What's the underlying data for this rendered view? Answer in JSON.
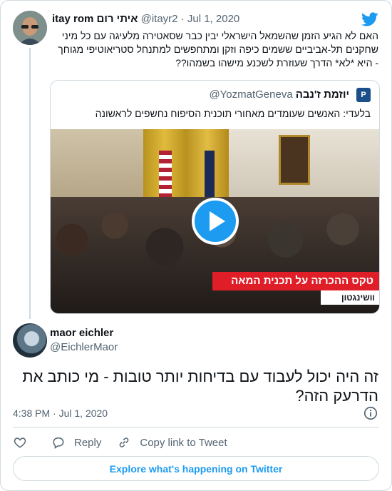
{
  "parent_tweet": {
    "name": "itay rom איתי רום",
    "handle": "@itayr2",
    "date": "Jul 1, 2020",
    "text": "האם לא הגיע הזמן שהשמאל הישראלי יבין כבר שסאטירה מלעיגה עם כל מיני שחקנים תל-אביביים ששמים כיפה וזקן ומתחפשים למתנחל סטריאוטיפי מגוחך - היא *לא* הדרך שעוזרת לשכנע מישהו בשמהו??"
  },
  "quoted_tweet": {
    "name": "יוזמת ז'נבה",
    "handle": "@YozmatGeneva",
    "text": "בלעדי: האנשים שעומדים מאחורי תוכנית הסיפוח נחשפים לראשונה",
    "video_banner": "טקס ההכרזה על תכנית המאה",
    "video_location": "וושינגטון"
  },
  "reply_tweet": {
    "name": "maor eichler",
    "handle": "@EichlerMaor",
    "text": "זה היה יכול לעבוד עם בדיחות יותר טובות - מי כותב את הדרעק הזה?",
    "time": "4:38 PM",
    "date": "Jul 1, 2020"
  },
  "actions": {
    "reply_label": "Reply",
    "copy_link_label": "Copy link to Tweet"
  },
  "explore_label": "Explore what's happening on Twitter",
  "colors": {
    "accent": "#1d9bf0",
    "text": "#0f1419",
    "secondary": "#536471",
    "border": "#cfd9de",
    "banner_red": "#e01e28"
  },
  "icons": [
    "twitter-bird-icon",
    "play-icon",
    "info-icon",
    "heart-icon",
    "reply-icon",
    "link-icon"
  ]
}
